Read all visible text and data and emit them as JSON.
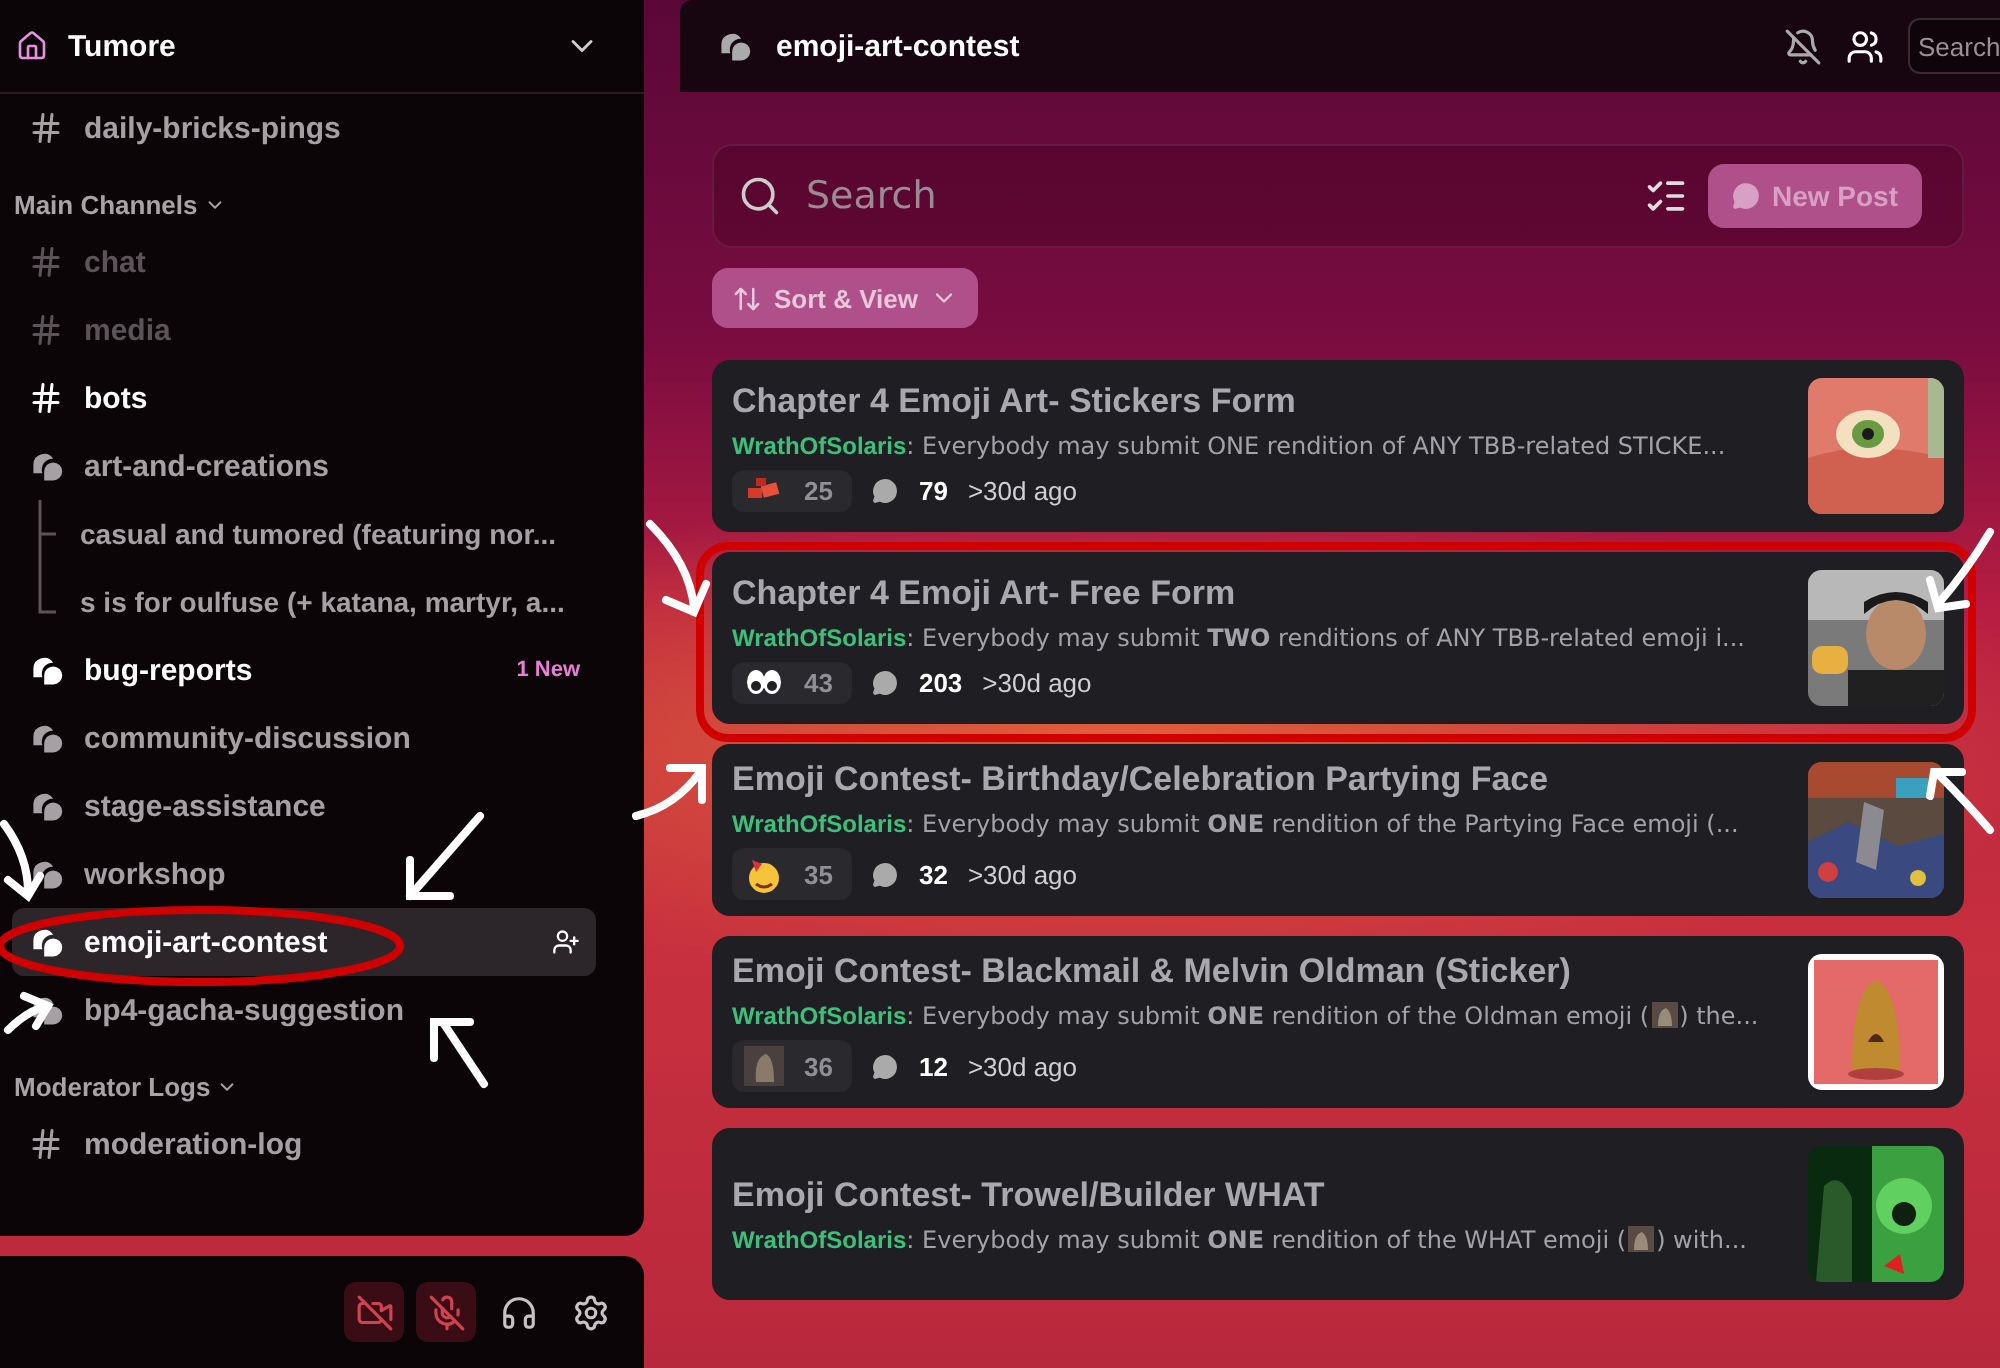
{
  "server": {
    "name": "Tumore"
  },
  "sidebar": {
    "sections": [
      {
        "items": [
          {
            "name": "daily-bricks-pings",
            "kind": "text",
            "muted": false,
            "unread": false,
            "selected": false
          }
        ]
      },
      {
        "label": "Main Channels",
        "expanded": true,
        "items": [
          {
            "name": "chat",
            "kind": "text",
            "muted": true,
            "unread": false,
            "selected": false
          },
          {
            "name": "media",
            "kind": "text",
            "muted": true,
            "unread": false,
            "selected": false
          },
          {
            "name": "bots",
            "kind": "text",
            "muted": false,
            "unread": true,
            "selected": false
          },
          {
            "name": "art-and-creations",
            "kind": "forum",
            "muted": false,
            "unread": false,
            "selected": false,
            "children": [
              {
                "name": "casual and tumored (featuring nor...",
                "muted": false,
                "unread": false,
                "selected": false
              },
              {
                "name": "s is for oulfuse (+ katana, martyr, a...",
                "muted": false,
                "unread": false,
                "selected": false
              }
            ]
          },
          {
            "name": "bug-reports",
            "kind": "forum",
            "muted": false,
            "unread": true,
            "selected": false,
            "badge": "1 New"
          },
          {
            "name": "community-discussion",
            "kind": "forum",
            "muted": false,
            "unread": false,
            "selected": false
          },
          {
            "name": "stage-assistance",
            "kind": "forum",
            "muted": false,
            "unread": false,
            "selected": false
          },
          {
            "name": "workshop",
            "kind": "forum",
            "muted": false,
            "unread": false,
            "selected": false
          },
          {
            "name": "emoji-art-contest",
            "kind": "forum",
            "muted": false,
            "unread": false,
            "selected": true
          },
          {
            "name": "bp4-gacha-suggestion",
            "kind": "forum",
            "muted": false,
            "unread": false,
            "selected": false
          }
        ]
      },
      {
        "label": "Moderator Logs",
        "expanded": true,
        "items": [
          {
            "name": "moderation-log",
            "kind": "text",
            "muted": false,
            "unread": false,
            "selected": false
          }
        ]
      }
    ]
  },
  "user_controls": [
    {
      "muted": true
    },
    {
      "muted": true
    },
    {
      "muted": false
    },
    {
      "muted": false
    }
  ],
  "channel_header": {
    "title": "emoji-art-contest",
    "search": {
      "placeholder": "Search"
    }
  },
  "forum": {
    "search": {
      "placeholder": "Search"
    },
    "new_post": {
      "label": "New Post",
      "disabled": true
    },
    "sort": {
      "label": "Sort & View"
    },
    "author_separator": ":",
    "posts": [
      {
        "title": "Chapter 4 Emoji Art- Stickers Form",
        "author": "WrathOfSolaris",
        "description": [
          "Everybody may submit ONE rendition of ANY TBB-related STICKE..."
        ],
        "reactions": "25",
        "replies": "79",
        "time": ">30d ago"
      },
      {
        "title": "Chapter 4 Emoji Art- Free Form",
        "author": "WrathOfSolaris",
        "description": [
          "Everybody may submit **TWO** renditions of ANY TBB-related emoji i..."
        ],
        "reactions": "43",
        "replies": "203",
        "time": ">30d ago"
      },
      {
        "title": "Emoji Contest- Birthday/Celebration Partying Face",
        "author": "WrathOfSolaris",
        "description": [
          "Everybody may submit **ONE** rendition of the Partying Face emoji (..."
        ],
        "reactions": "35",
        "replies": "32",
        "time": ">30d ago"
      },
      {
        "title": "Emoji Contest- Blackmail & Melvin Oldman (Sticker)",
        "author": "WrathOfSolaris",
        "description": [
          "Everybody may submit **ONE** rendition of the Oldman emoji (",
          ") the..."
        ],
        "reactions": "36",
        "replies": "12",
        "time": ">30d ago"
      },
      {
        "title": "Emoji Contest- Trowel/Builder WHAT",
        "author": "WrathOfSolaris",
        "description": [
          "Everybody may submit **ONE** rendition of the WHAT emoji (",
          ") with..."
        ]
      }
    ]
  }
}
